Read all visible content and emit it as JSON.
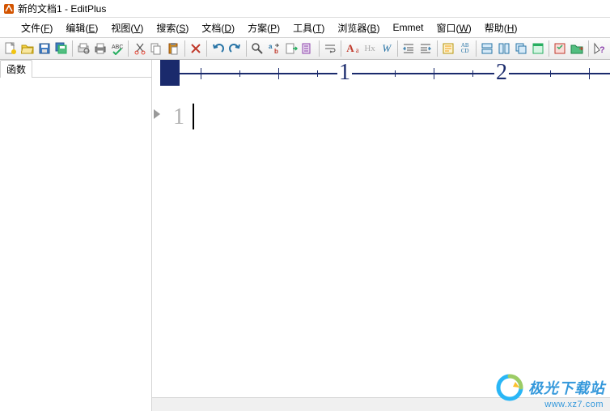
{
  "title": "新的文档1 - EditPlus",
  "menus": {
    "file": {
      "label": "文件(",
      "accel": "F",
      "post": ")"
    },
    "edit": {
      "label": "编辑(",
      "accel": "E",
      "post": ")"
    },
    "view": {
      "label": "视图(",
      "accel": "V",
      "post": ")"
    },
    "search": {
      "label": "搜索(",
      "accel": "S",
      "post": ")"
    },
    "doc": {
      "label": "文档(",
      "accel": "D",
      "post": ")"
    },
    "proj": {
      "label": "方案(",
      "accel": "P",
      "post": ")"
    },
    "tools": {
      "label": "工具(",
      "accel": "T",
      "post": ")"
    },
    "browser": {
      "label": "浏览器(",
      "accel": "B",
      "post": ")"
    },
    "emmet": {
      "label": "Emmet",
      "accel": "",
      "post": ""
    },
    "window": {
      "label": "窗口(",
      "accel": "W",
      "post": ")"
    },
    "help": {
      "label": "帮助(",
      "accel": "H",
      "post": ")"
    }
  },
  "sidebar": {
    "tab_label": "函数"
  },
  "toolbar_text": {
    "aa": "A",
    "aa2": "a",
    "hx": "Hx",
    "w": "W",
    "abcd": "AB\nCD"
  },
  "ruler": {
    "marks": [
      "1",
      "2"
    ]
  },
  "editor": {
    "line_number": "1"
  },
  "watermark": {
    "brand": "极光下载站",
    "url": "www.xz7.com"
  }
}
